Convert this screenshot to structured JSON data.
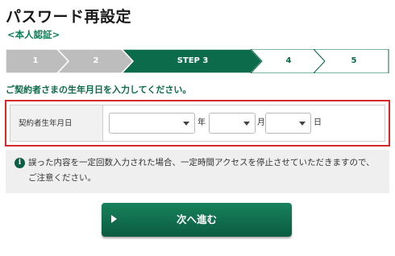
{
  "page": {
    "title": "パスワード再設定",
    "subtitle": "<本人認証>"
  },
  "steps": [
    {
      "label": "1",
      "state": "done"
    },
    {
      "label": "2",
      "state": "done"
    },
    {
      "label": "STEP 3",
      "state": "current"
    },
    {
      "label": "4",
      "state": "todo"
    },
    {
      "label": "5",
      "state": "todo"
    }
  ],
  "colors": {
    "done_fill": "#bdbdbd",
    "current_fill": "#0b6b4b",
    "todo_fill": "#ffffff",
    "accent_green": "#0b7d57",
    "highlight_border": "#d42a2a"
  },
  "instruction": "ご契約者さまの生年月日を入力してください。",
  "birthdate": {
    "label": "契約者生年月日",
    "year": {
      "value": "",
      "suffix": "年"
    },
    "month": {
      "value": "",
      "suffix": "月"
    },
    "day": {
      "value": "",
      "suffix": "日"
    }
  },
  "notice": {
    "icon": "info-icon",
    "text": "誤った内容を一定回数入力された場合、一定時間アクセスを停止させていただきますので、ご注意ください。"
  },
  "next_button": {
    "label": "次へ進む",
    "icon": "play-arrow-icon"
  }
}
